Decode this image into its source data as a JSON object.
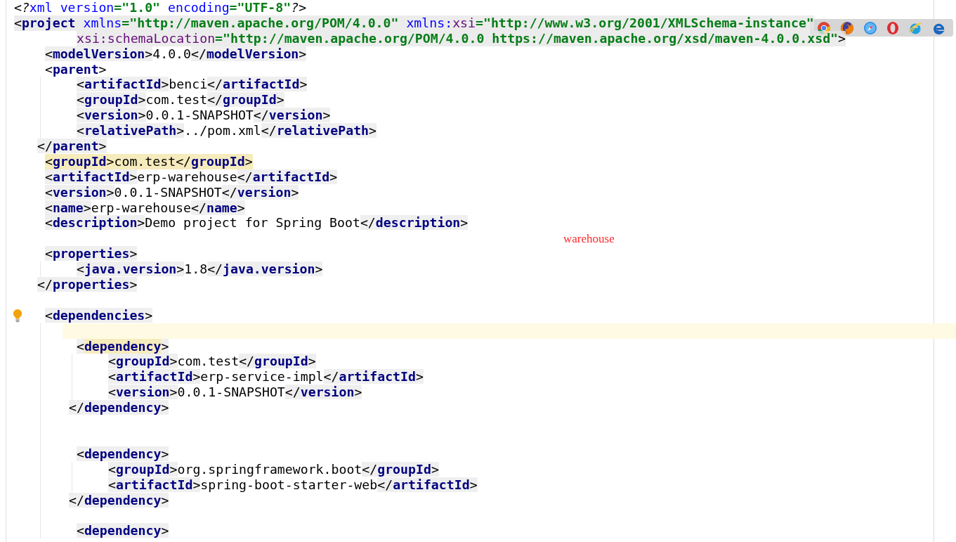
{
  "editor": {
    "lines": [
      {
        "kind": "code",
        "tokens": [
          {
            "kind": "pi",
            "text": "<?"
          },
          {
            "kind": "pi-name",
            "text": "xml"
          },
          {
            "kind": "attr",
            "text": "version"
          },
          {
            "kind": "value",
            "text": "=\"1.0\""
          },
          {
            "kind": "attr",
            "text": "encoding"
          },
          {
            "kind": "value",
            "text": "=\"UTF-8\""
          },
          {
            "kind": "pi",
            "text": "?>"
          }
        ]
      },
      {
        "kind": "shaded-code",
        "tokens": [
          {
            "kind": "bare-tag",
            "open": "<",
            "name": "project"
          },
          {
            "kind": "attr",
            "text": "xmlns"
          },
          {
            "kind": "value",
            "text": "=\"http://maven.apache.org/POM/4.0.0\""
          },
          {
            "kind": "attr",
            "text": "xmlns:"
          },
          {
            "kind": "ns",
            "text": "xsi"
          },
          {
            "kind": "value",
            "text": "=\"http://www.w3.org/2001/XMLSchema-instance\""
          }
        ],
        "continuation": [
          {
            "kind": "ns",
            "text": "xsi:schemaLocation"
          },
          {
            "kind": "value",
            "text": "=\"http://maven.apache.org/POM/4.0.0 https://maven.apache.org/xsd/maven-4.0.0.xsd\""
          },
          {
            "kind": "bracket",
            "text": ">"
          }
        ],
        "children": [
          {
            "kind": "code",
            "tokens": [
              {
                "kind": "tag",
                "open": "<",
                "name": "modelVersion",
                "close": ">"
              },
              {
                "kind": "text",
                "text": "4.0.0"
              },
              {
                "kind": "tag",
                "open": "</",
                "name": "modelVersion",
                "close": ">"
              }
            ]
          },
          {
            "kind": "code",
            "tokens": [
              {
                "kind": "bare-tag",
                "open": "<",
                "name": "parent",
                "close": ">"
              }
            ],
            "children": [
              {
                "kind": "code",
                "tokens": [
                  {
                    "kind": "tag",
                    "open": "<",
                    "name": "artifactId",
                    "close": ">"
                  },
                  {
                    "kind": "text",
                    "text": "benci"
                  },
                  {
                    "kind": "tag",
                    "open": "</",
                    "name": "artifactId",
                    "close": ">"
                  }
                ]
              },
              {
                "kind": "code",
                "tokens": [
                  {
                    "kind": "tag",
                    "open": "<",
                    "name": "groupId",
                    "close": ">"
                  },
                  {
                    "kind": "text",
                    "text": "com.test"
                  },
                  {
                    "kind": "tag",
                    "open": "</",
                    "name": "groupId",
                    "close": ">"
                  }
                ]
              },
              {
                "kind": "code",
                "tokens": [
                  {
                    "kind": "tag",
                    "open": "<",
                    "name": "version",
                    "close": ">"
                  },
                  {
                    "kind": "text",
                    "text": "0.0.1-SNAPSHOT"
                  },
                  {
                    "kind": "tag",
                    "open": "</",
                    "name": "version",
                    "close": ">"
                  }
                ]
              },
              {
                "kind": "code",
                "tokens": [
                  {
                    "kind": "tag",
                    "open": "<",
                    "name": "relativePath",
                    "close": ">"
                  },
                  {
                    "kind": "text",
                    "text": "../pom.xml"
                  },
                  {
                    "kind": "tag",
                    "open": "</",
                    "name": "relativePath",
                    "close": ">"
                  }
                ]
              }
            ],
            "closing": [
              {
                "kind": "tag",
                "open": "</",
                "name": "parent",
                "close": ">"
              }
            ]
          },
          {
            "kind": "matched-code",
            "tokens": [
              {
                "kind": "bare-tag",
                "open": "<",
                "name": "groupId",
                "close": ">"
              },
              {
                "kind": "text",
                "text": "com.test"
              },
              {
                "kind": "bare-tag",
                "open": "</",
                "name": "groupId",
                "close": ">"
              }
            ]
          },
          {
            "kind": "code",
            "tokens": [
              {
                "kind": "tag",
                "open": "<",
                "name": "artifactId",
                "close": ">"
              },
              {
                "kind": "text",
                "text": "erp-warehouse"
              },
              {
                "kind": "tag",
                "open": "</",
                "name": "artifactId",
                "close": ">"
              }
            ]
          },
          {
            "kind": "code",
            "tokens": [
              {
                "kind": "tag",
                "open": "<",
                "name": "version",
                "close": ">"
              },
              {
                "kind": "text",
                "text": "0.0.1-SNAPSHOT"
              },
              {
                "kind": "tag",
                "open": "</",
                "name": "version",
                "close": ">"
              }
            ]
          },
          {
            "kind": "code",
            "tokens": [
              {
                "kind": "tag",
                "open": "<",
                "name": "name",
                "close": ">"
              },
              {
                "kind": "text",
                "text": "erp-warehouse"
              },
              {
                "kind": "tag",
                "open": "</",
                "name": "name",
                "close": ">"
              }
            ]
          },
          {
            "kind": "code",
            "tokens": [
              {
                "kind": "tag",
                "open": "<",
                "name": "description",
                "close": ">"
              },
              {
                "kind": "text",
                "text": "Demo project for Spring Boot"
              },
              {
                "kind": "tag",
                "open": "</",
                "name": "description",
                "close": ">"
              }
            ]
          },
          {
            "kind": "blank"
          },
          {
            "kind": "code",
            "tokens": [
              {
                "kind": "tag",
                "open": "<",
                "name": "properties",
                "close": ">"
              }
            ],
            "children": [
              {
                "kind": "code",
                "tokens": [
                  {
                    "kind": "tag",
                    "open": "<",
                    "name": "java.version",
                    "close": ">"
                  },
                  {
                    "kind": "text",
                    "text": "1.8"
                  },
                  {
                    "kind": "tag",
                    "open": "</",
                    "name": "java.version",
                    "close": ">"
                  }
                ]
              }
            ],
            "closing": [
              {
                "kind": "tag",
                "open": "</",
                "name": "properties",
                "close": ">"
              }
            ]
          },
          {
            "kind": "blank"
          },
          {
            "kind": "code",
            "intention_bulb": true,
            "tokens": [
              {
                "kind": "tag",
                "open": "<",
                "name": "dependencies",
                "close": ">"
              }
            ],
            "children": [
              {
                "kind": "caret-line"
              },
              {
                "kind": "code",
                "tokens": [
                  {
                    "kind": "matched-tag",
                    "open": "<",
                    "name": "dependency",
                    "close": ">"
                  }
                ],
                "children": [
                  {
                    "kind": "code",
                    "tokens": [
                      {
                        "kind": "tag",
                        "open": "<",
                        "name": "groupId",
                        "close": ">"
                      },
                      {
                        "kind": "text",
                        "text": "com.test"
                      },
                      {
                        "kind": "tag",
                        "open": "</",
                        "name": "groupId",
                        "close": ">"
                      }
                    ]
                  },
                  {
                    "kind": "code",
                    "tokens": [
                      {
                        "kind": "tag",
                        "open": "<",
                        "name": "artifactId",
                        "close": ">"
                      },
                      {
                        "kind": "text",
                        "text": "erp-service-impl"
                      },
                      {
                        "kind": "tag",
                        "open": "</",
                        "name": "artifactId",
                        "close": ">"
                      }
                    ]
                  },
                  {
                    "kind": "code",
                    "tokens": [
                      {
                        "kind": "tag",
                        "open": "<",
                        "name": "version",
                        "close": ">"
                      },
                      {
                        "kind": "text",
                        "text": "0.0.1-SNAPSHOT"
                      },
                      {
                        "kind": "tag",
                        "open": "</",
                        "name": "version",
                        "close": ">"
                      }
                    ]
                  }
                ],
                "closing": [
                  {
                    "kind": "tag",
                    "open": "</",
                    "name": "dependency",
                    "close": ">"
                  }
                ]
              },
              {
                "kind": "blank"
              },
              {
                "kind": "blank"
              },
              {
                "kind": "code",
                "tokens": [
                  {
                    "kind": "tag",
                    "open": "<",
                    "name": "dependency",
                    "close": ">"
                  }
                ],
                "children": [
                  {
                    "kind": "code",
                    "tokens": [
                      {
                        "kind": "tag",
                        "open": "<",
                        "name": "groupId",
                        "close": ">"
                      },
                      {
                        "kind": "text",
                        "text": "org.springframework.boot"
                      },
                      {
                        "kind": "tag",
                        "open": "</",
                        "name": "groupId",
                        "close": ">"
                      }
                    ]
                  },
                  {
                    "kind": "code",
                    "tokens": [
                      {
                        "kind": "tag",
                        "open": "<",
                        "name": "artifactId",
                        "close": ">"
                      },
                      {
                        "kind": "text",
                        "text": "spring-boot-starter-web"
                      },
                      {
                        "kind": "tag",
                        "open": "</",
                        "name": "artifactId",
                        "close": ">"
                      }
                    ]
                  }
                ],
                "closing": [
                  {
                    "kind": "tag",
                    "open": "</",
                    "name": "dependency",
                    "close": ">"
                  }
                ]
              },
              {
                "kind": "blank"
              },
              {
                "kind": "code",
                "tokens": [
                  {
                    "kind": "tag",
                    "open": "<",
                    "name": "dependency",
                    "close": ">"
                  }
                ]
              }
            ]
          }
        ]
      }
    ]
  },
  "annotation": {
    "text": "warehouse"
  },
  "browser_bar": {
    "browsers": [
      {
        "kind": "chrome"
      },
      {
        "kind": "firefox"
      },
      {
        "kind": "safari"
      },
      {
        "kind": "opera"
      },
      {
        "kind": "ie"
      },
      {
        "kind": "edge"
      }
    ]
  }
}
